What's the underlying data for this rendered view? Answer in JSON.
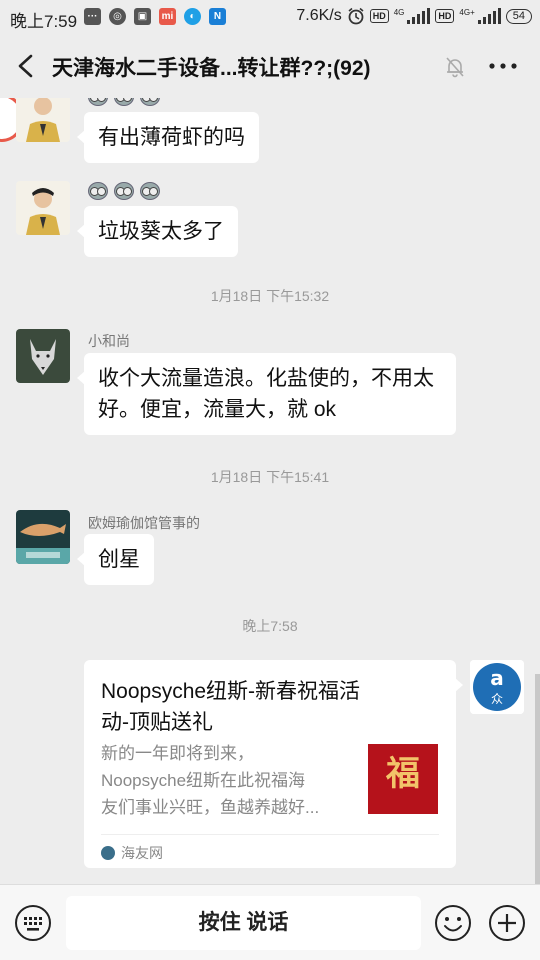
{
  "status_bar": {
    "time": "晚上7:59",
    "speed": "7.6K/s",
    "battery": "54",
    "hd": "HD",
    "net_4g": "4G",
    "net_4g_plus": "4G+"
  },
  "header": {
    "title": "天津海水二手设备...转让群??;(92)"
  },
  "messages": [
    {
      "sender": "",
      "text": "有出薄荷虾的吗",
      "avatar_icon": "man-in-suit-avatar"
    },
    {
      "sender": "",
      "text": "垃圾葵太多了",
      "avatar_icon": "man-in-suit-avatar"
    },
    {
      "sender": "小和尚",
      "lines": [
        "收个大流量造浪。化盐使的，不用太",
        "好。便宜，流量大，就 ok"
      ],
      "avatar_icon": "wolf-avatar"
    },
    {
      "sender": "欧姆瑜伽馆管事的",
      "text": "创星",
      "avatar_icon": "aquarium-avatar"
    }
  ],
  "timestamps": [
    "1月18日 下午15:32",
    "1月18日 下午15:41",
    "晚上7:58"
  ],
  "link_card": {
    "title_lines": [
      "Noopsyche纽斯-新春祝福活",
      "动-顶贴送礼"
    ],
    "desc_lines": [
      "新的一年即将到来，",
      "Noopsyche纽斯在此祝福海",
      "友们事业兴旺，鱼越养越好..."
    ],
    "thumb_glyph": "福",
    "source": "海友网"
  },
  "input_bar": {
    "voice_label": "按住 说话"
  },
  "colors": {
    "background": "#ededed",
    "bubble": "#ffffff",
    "thumb_red": "#b5121b"
  }
}
